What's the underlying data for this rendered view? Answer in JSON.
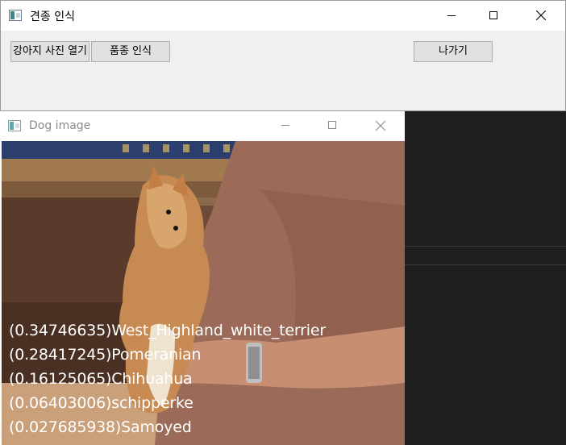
{
  "main_window": {
    "title": "견종 인식",
    "buttons": {
      "open_photo": "강아지 사진 열기",
      "breed_recognition": "품종 인식",
      "exit": "나가기"
    }
  },
  "image_window": {
    "title": "Dog image",
    "predictions": [
      {
        "text": "(0.34746635)West_Highland_white_terrier"
      },
      {
        "text": "(0.28417245)Pomeranian"
      },
      {
        "text": "(0.16125065)Chihuahua"
      },
      {
        "text": "(0.06403006)schipperke"
      },
      {
        "text": "(0.027685938)Samoyed"
      }
    ]
  },
  "icons": [
    "app-icon",
    "minimize-icon",
    "maximize-icon",
    "close-icon"
  ]
}
